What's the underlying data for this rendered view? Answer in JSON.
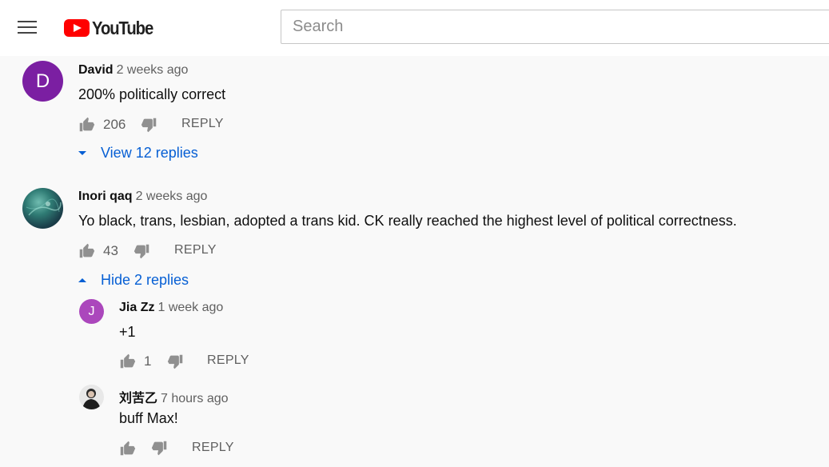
{
  "header": {
    "logo_text": "YouTube",
    "search_placeholder": "Search"
  },
  "comments": [
    {
      "author": "David",
      "time": "2 weeks ago",
      "avatar_letter": "D",
      "avatar_color": "#7b1fa2",
      "text": "200% politically correct",
      "likes": "206",
      "reply_label": "REPLY",
      "toggle_label": "View 12 replies"
    },
    {
      "author": "Inori qaq",
      "time": "2 weeks ago",
      "text": "Yo black, trans, lesbian, adopted a trans kid. CK really reached the highest level of political correctness.",
      "likes": "43",
      "reply_label": "REPLY",
      "toggle_label": "Hide 2 replies",
      "replies": [
        {
          "author": "Jia Zz",
          "time": "1 week ago",
          "avatar_letter": "J",
          "avatar_color": "#ab47bc",
          "text": "+1",
          "likes": "1",
          "reply_label": "REPLY"
        },
        {
          "author": "刘苦乙",
          "time": "7 hours ago",
          "text": "buff Max!",
          "likes": "",
          "reply_label": "REPLY"
        }
      ]
    }
  ],
  "colors": {
    "link": "#065fd4",
    "brand": "#ff0000",
    "meta": "#606060"
  }
}
